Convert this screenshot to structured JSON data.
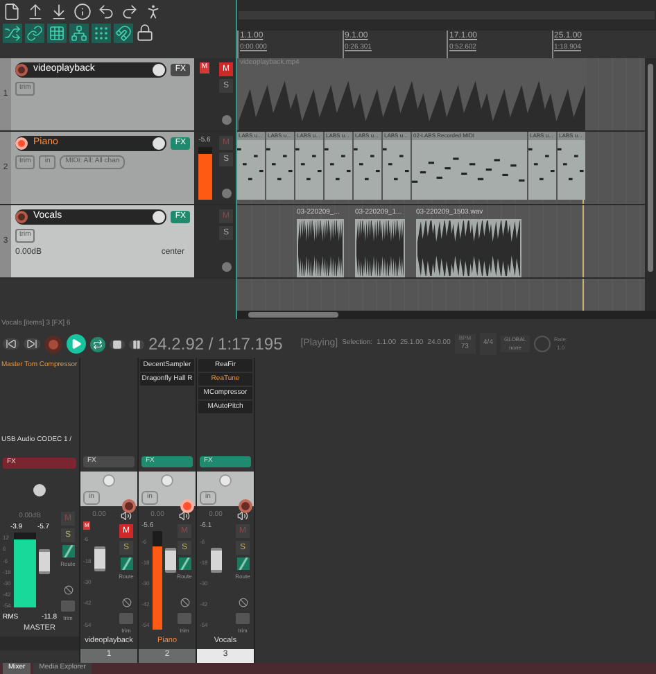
{
  "tracks": [
    {
      "number": "1",
      "name": "videoplayback",
      "armed": false,
      "selected": false,
      "muted": true,
      "name_highlight": false,
      "fx_on": false,
      "fx_label": "FX",
      "trim_label": "trim",
      "mute_label": "M",
      "solo_label": "S",
      "mute_flag": "M"
    },
    {
      "number": "2",
      "name": "Piano",
      "armed": true,
      "selected": false,
      "muted": false,
      "name_highlight": true,
      "fx_on": true,
      "fx_label": "FX",
      "trim_label": "trim",
      "input": "in",
      "midi_input": "MIDI: All: All chan",
      "mute_label": "M",
      "solo_label": "S",
      "peak": "-5.6",
      "level": 0.85
    },
    {
      "number": "3",
      "name": "Vocals",
      "armed": false,
      "selected": true,
      "muted": false,
      "name_highlight": false,
      "fx_on": true,
      "fx_label": "FX",
      "trim_label": "trim",
      "volume": "0.00dB",
      "pan": "center",
      "mute_label": "M",
      "solo_label": "S"
    }
  ],
  "ruler": [
    {
      "bar": "1.1.00",
      "time": "0:00.000"
    },
    {
      "bar": "9.1.00",
      "time": "0:26.301"
    },
    {
      "bar": "17.1.00",
      "time": "0:52.602"
    },
    {
      "bar": "25.1.00",
      "time": "1:18.904"
    }
  ],
  "lanes": [
    {
      "kind": "audio",
      "items": [
        "videoplayback.mp4"
      ]
    },
    {
      "kind": "midi",
      "items": [
        "LABS u...",
        "LABS u...",
        "LABS u...",
        "LABS u...",
        "LABS u...",
        "LABS u...",
        "02-LABS Recorded MIDI",
        "LABS u...",
        "LABS u..."
      ]
    },
    {
      "kind": "vocal",
      "items": [
        "03-220209_...",
        "03-220209_1...",
        "03-220209_1503.wav"
      ]
    }
  ],
  "status": "Vocals [items] 3 [FX] 6",
  "transport": {
    "playing": true,
    "recording": false,
    "repeat": true,
    "position": "24.2.92 / 1:17.195",
    "state": "[Playing]",
    "selection_label": "Selection:",
    "selection": [
      "1.1.00",
      "25.1.00",
      "24.0.00"
    ],
    "bpm_label": "BPM",
    "bpm": "73",
    "time_signature": "4/4",
    "global_label": "GLOBAL",
    "global_value": "none",
    "rate_label": "Rate:",
    "rate": "1.0"
  },
  "master": {
    "fx": [
      {
        "name": "Master Tom Compressor",
        "highlight": true
      }
    ],
    "input": "USB Audio CODEC 1 /",
    "fx_label": "FX",
    "fx_bypassed": true,
    "volume": "0.00dB",
    "peaks": [
      "-3.9",
      "-5.7"
    ],
    "scale": [
      "12",
      "6",
      "-6",
      "-18",
      "-30",
      "-42",
      "-54"
    ],
    "level": 0.9,
    "rms_label": "RMS",
    "rms": "-11.8",
    "mute_label": "M",
    "solo_label": "S",
    "route_label": "Route",
    "trim_label": "trim",
    "name": "MASTER"
  },
  "channels": [
    {
      "name": "videoplayback",
      "number": "1",
      "selected": false,
      "armed": false,
      "muted": true,
      "name_highlight": false,
      "fx_label": "FX",
      "fx_on": false,
      "input": "in",
      "volume": "0.00",
      "mute_flag": "M",
      "mute_label": "M",
      "solo_label": "S",
      "route_label": "Route",
      "trim_label": "trim",
      "scale": [
        "-6",
        "-18",
        "-30",
        "-42",
        "-54"
      ]
    },
    {
      "name": "Piano",
      "number": "2",
      "selected": false,
      "armed": true,
      "muted": false,
      "name_highlight": true,
      "fx": [
        {
          "name": "DecentSampler",
          "highlight": false
        },
        {
          "name": "Dragonfly Hall R",
          "highlight": false
        }
      ],
      "fx_label": "FX",
      "fx_on": true,
      "input": "in",
      "volume": "0.00",
      "peak": "-5.6",
      "level": 0.85,
      "mute_label": "M",
      "solo_label": "S",
      "route_label": "Route",
      "trim_label": "trim",
      "scale": [
        "-6",
        "-18",
        "-30",
        "-42",
        "-54"
      ]
    },
    {
      "name": "Vocals",
      "number": "3",
      "selected": true,
      "armed": false,
      "muted": false,
      "name_highlight": false,
      "fx": [
        {
          "name": "ReaFir",
          "highlight": false
        },
        {
          "name": "ReaTune",
          "highlight": true
        },
        {
          "name": "MCompressor",
          "highlight": false
        },
        {
          "name": "MAutoPitch",
          "highlight": false
        }
      ],
      "fx_label": "FX",
      "fx_on": true,
      "input": "in",
      "volume": "0.00",
      "peak": "-6.1",
      "mute_label": "M",
      "solo_label": "S",
      "route_label": "Route",
      "trim_label": "trim",
      "scale": [
        "-6",
        "-18",
        "-30",
        "-42",
        "-54"
      ]
    }
  ],
  "dock_tabs": [
    {
      "label": "Mixer",
      "selected": true
    },
    {
      "label": "Media Explorer",
      "selected": false
    }
  ]
}
